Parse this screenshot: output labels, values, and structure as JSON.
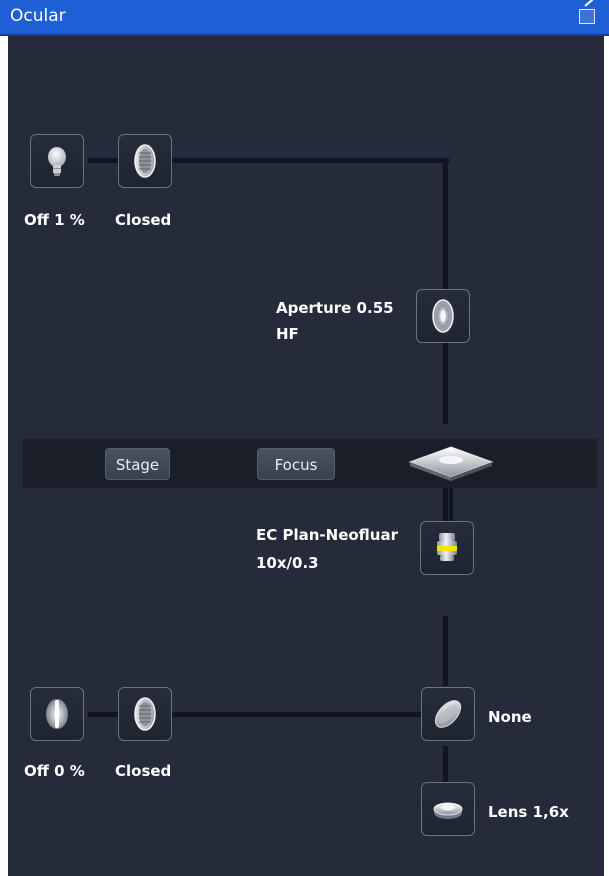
{
  "window": {
    "title": "Ocular"
  },
  "upper_path": {
    "lamp": {
      "state": "Off",
      "percent": "1 %",
      "label": "Off 1 %"
    },
    "shutter": {
      "label": "Closed"
    }
  },
  "condenser": {
    "label_line1": "Aperture 0.55",
    "label_line2": "HF"
  },
  "stage_bar": {
    "stage_label": "Stage",
    "focus_label": "Focus"
  },
  "objective": {
    "name": "EC Plan-Neofluar",
    "magnification": "10x/0.3"
  },
  "lower_path": {
    "lamp": {
      "state": "Off",
      "percent": "0 %",
      "label": "Off 0 %"
    },
    "shutter": {
      "label": "Closed"
    },
    "filter": {
      "label": "None"
    },
    "tube_lens": {
      "label": "Lens 1,6x"
    }
  },
  "icons": [
    "lamp-icon",
    "shutter-icon",
    "aperture-icon",
    "stage-icon",
    "objective-icon",
    "halogen-lamp-icon",
    "filter-icon",
    "lens-icon",
    "undock-icon"
  ]
}
